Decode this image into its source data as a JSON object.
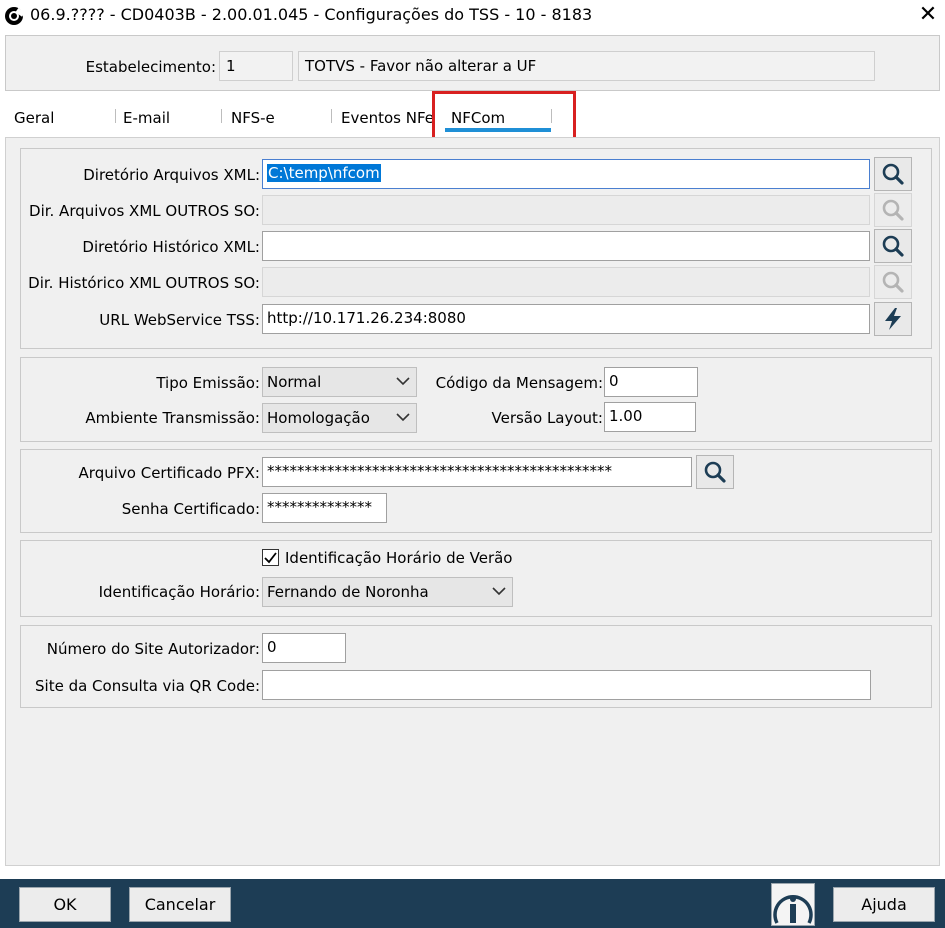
{
  "window": {
    "title": "06.9.???? - CD0403B - 2.00.01.045 - Configurações do TSS - 10 - 8183",
    "close_glyph": "✕"
  },
  "establishment": {
    "label": "Estabelecimento:",
    "code": "1",
    "name": "TOTVS - Favor não alterar a UF"
  },
  "tabs": [
    {
      "label": "Geral"
    },
    {
      "label": "E-mail"
    },
    {
      "label": "NFS-e"
    },
    {
      "label": "Eventos NFe"
    },
    {
      "label": "NFCom",
      "active": true
    }
  ],
  "directories": {
    "xml_dir": {
      "label": "Diretório Arquivos XML:",
      "value": "C:\\temp\\nfcom"
    },
    "xml_dir_other": {
      "label": "Dir. Arquivos XML OUTROS SO:",
      "value": ""
    },
    "history_dir": {
      "label": "Diretório Histórico XML:",
      "value": ""
    },
    "history_dir_other": {
      "label": "Dir. Histórico XML OUTROS SO:",
      "value": ""
    },
    "ws_url": {
      "label": "URL WebService TSS:",
      "value": "http://10.171.26.234:8080"
    }
  },
  "emission": {
    "type_label": "Tipo Emissão:",
    "type_value": "Normal",
    "env_label": "Ambiente Transmissão:",
    "env_value": "Homologação",
    "msg_code_label": "Código da Mensagem:",
    "msg_code_value": "0",
    "layout_label": "Versão Layout:",
    "layout_value": "1.00"
  },
  "certificate": {
    "pfx_label": "Arquivo Certificado PFX:",
    "pfx_value": "**********************************************",
    "password_label": "Senha Certificado:",
    "password_value": "**************"
  },
  "timezone": {
    "dst_label": "Identificação Horário de Verão",
    "dst_checked": true,
    "zone_label": "Identificação Horário:",
    "zone_value": "Fernando de Noronha"
  },
  "site": {
    "number_label": "Número do Site Autorizador:",
    "number_value": "0",
    "qr_label": "Site da Consulta via QR Code:",
    "qr_value": ""
  },
  "footer": {
    "ok_label": "OK",
    "cancel_label": "Cancelar",
    "help_label": "Ajuda"
  },
  "colors": {
    "footer_bg": "#1d3d55",
    "active_tab_underline": "#1f8fd6",
    "highlight_box": "#d82020",
    "selection": "#0078d7"
  },
  "icons": {
    "search": "search-icon",
    "lightning": "lightning-icon",
    "info": "info-icon",
    "app": "app-logo-icon",
    "chevron": "chevron-down-icon",
    "check": "checkmark-icon"
  }
}
